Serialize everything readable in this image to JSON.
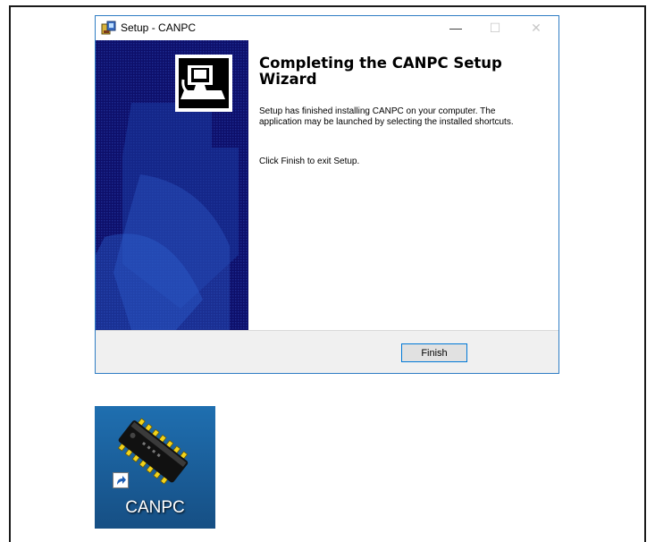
{
  "window": {
    "title": "Setup - CANPC",
    "controls": {
      "minimize": "—",
      "maximize": "☐",
      "close": "✕"
    }
  },
  "wizard": {
    "heading": "Completing the CANPC Setup Wizard",
    "message": "Setup has finished installing CANPC on your computer. The application may be launched by selecting the installed shortcuts.",
    "instruction": "Click Finish to exit Setup."
  },
  "footer": {
    "finish_label": "Finish"
  },
  "desktop_shortcut": {
    "label": "CANPC",
    "icon": "chip-icon"
  },
  "colors": {
    "banner": "#0d0f6a",
    "accent": "#0078d7",
    "window_border": "#2f7dc4"
  }
}
